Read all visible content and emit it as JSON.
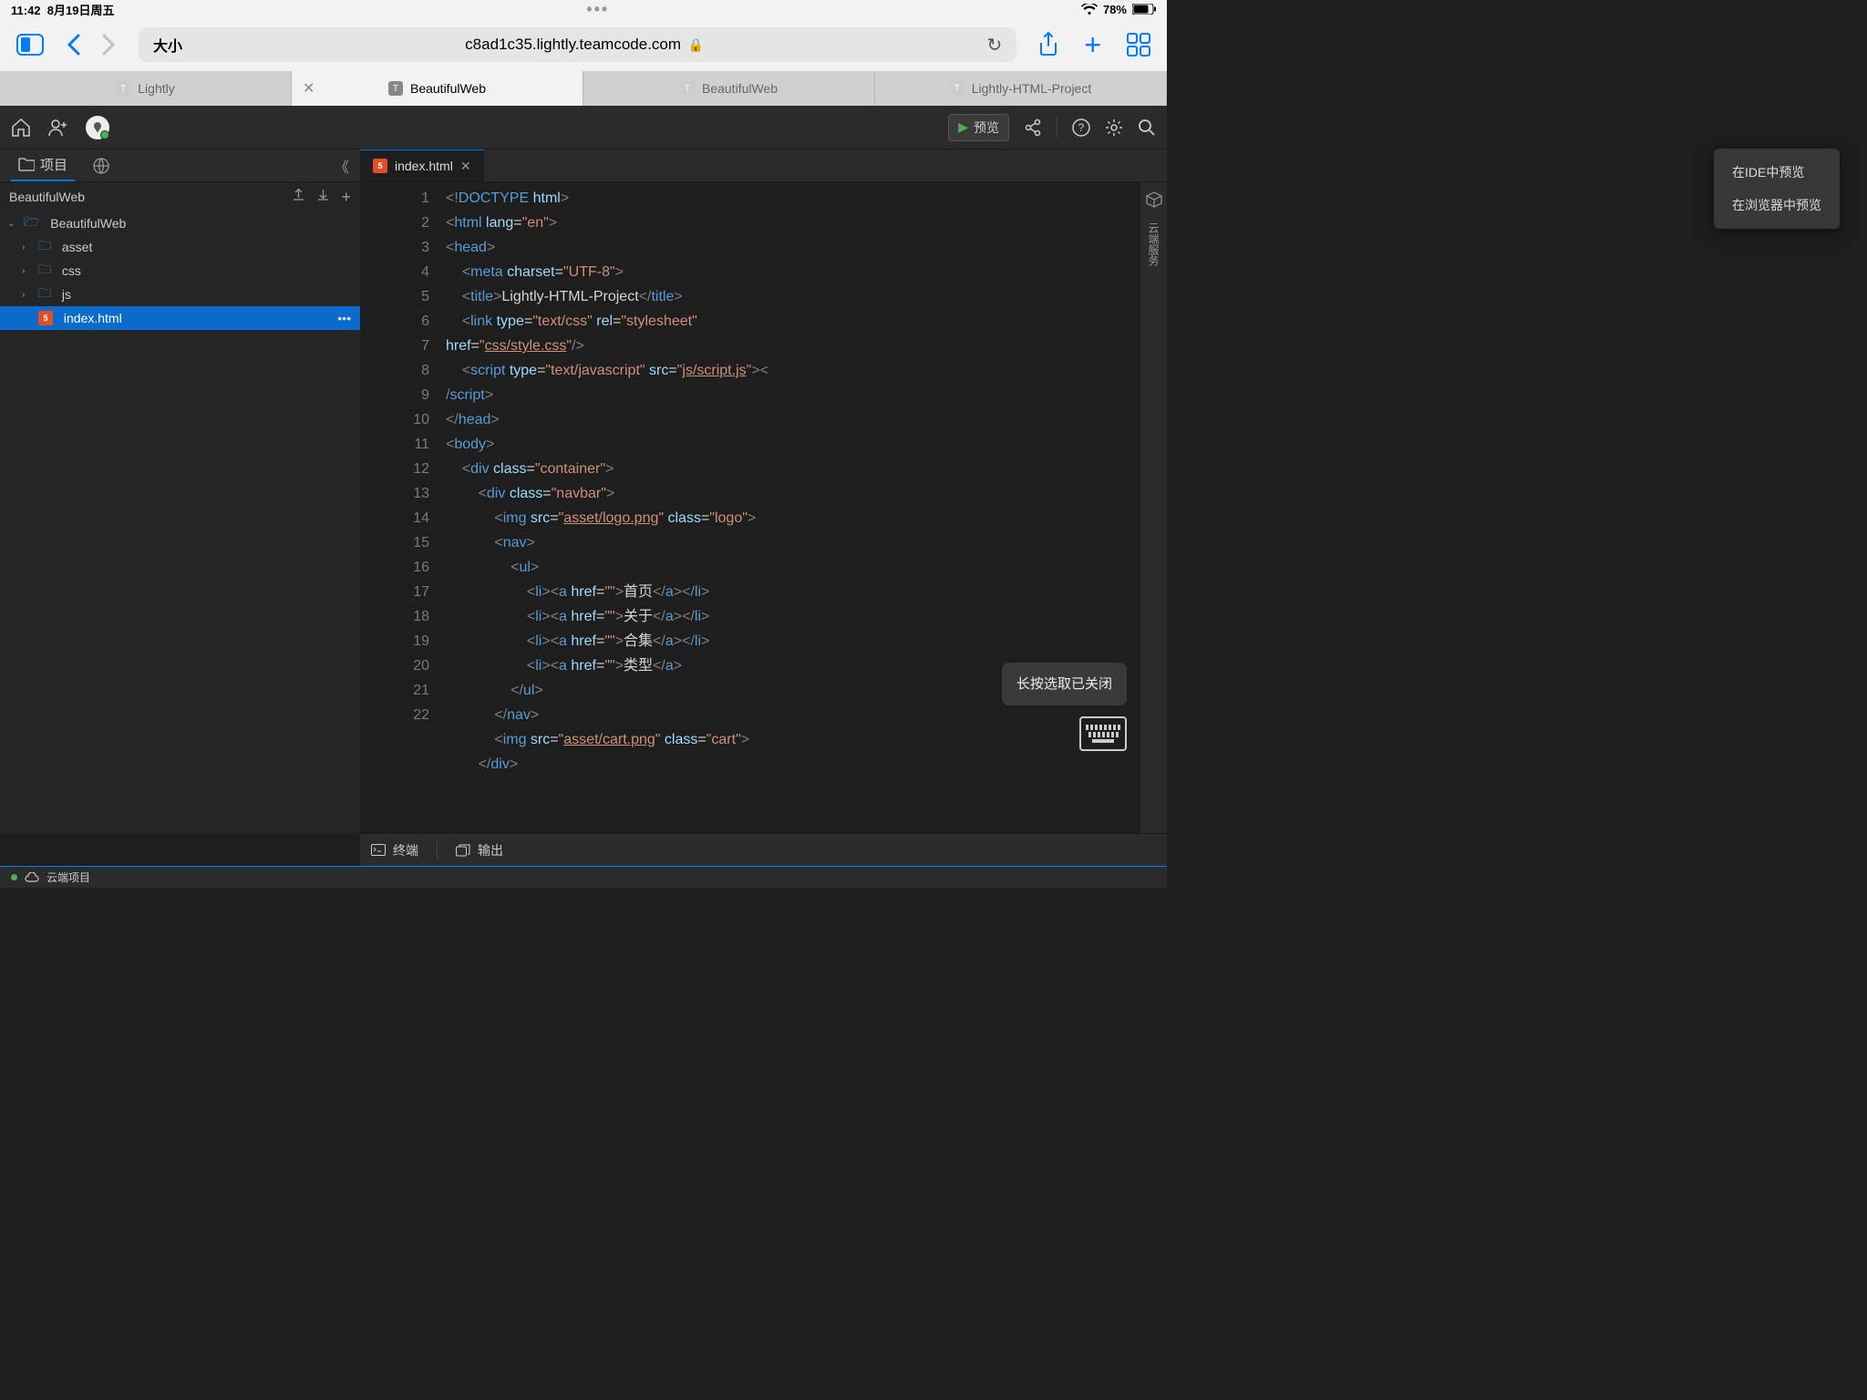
{
  "ios": {
    "time": "11:42",
    "date": "8月19日周五",
    "battery": "78%"
  },
  "safari": {
    "size_label": "大小",
    "url": "c8ad1c35.lightly.teamcode.com"
  },
  "browser_tabs": [
    {
      "label": "Lightly",
      "active": false
    },
    {
      "label": "BeautifulWeb",
      "active": true
    },
    {
      "label": "BeautifulWeb",
      "active": false
    },
    {
      "label": "Lightly-HTML-Project",
      "active": false
    }
  ],
  "ide": {
    "preview_btn": "预览",
    "preview_menu": [
      "在IDE中预览",
      "在浏览器中预览"
    ],
    "side_rail": "云端服务",
    "project_tab": "项目",
    "project_name": "BeautifulWeb",
    "tree": {
      "root": "BeautifulWeb",
      "folders": [
        "asset",
        "css",
        "js"
      ],
      "file": "index.html"
    },
    "editor_tab": "index.html",
    "bottom": {
      "terminal": "终端",
      "output": "输出"
    },
    "status": "云端项目",
    "toast": "长按选取已关闭"
  },
  "code_lines": [
    1,
    2,
    3,
    4,
    5,
    6,
    7,
    8,
    9,
    10,
    11,
    12,
    13,
    14,
    15,
    16,
    17,
    18,
    19,
    20,
    21,
    22
  ]
}
